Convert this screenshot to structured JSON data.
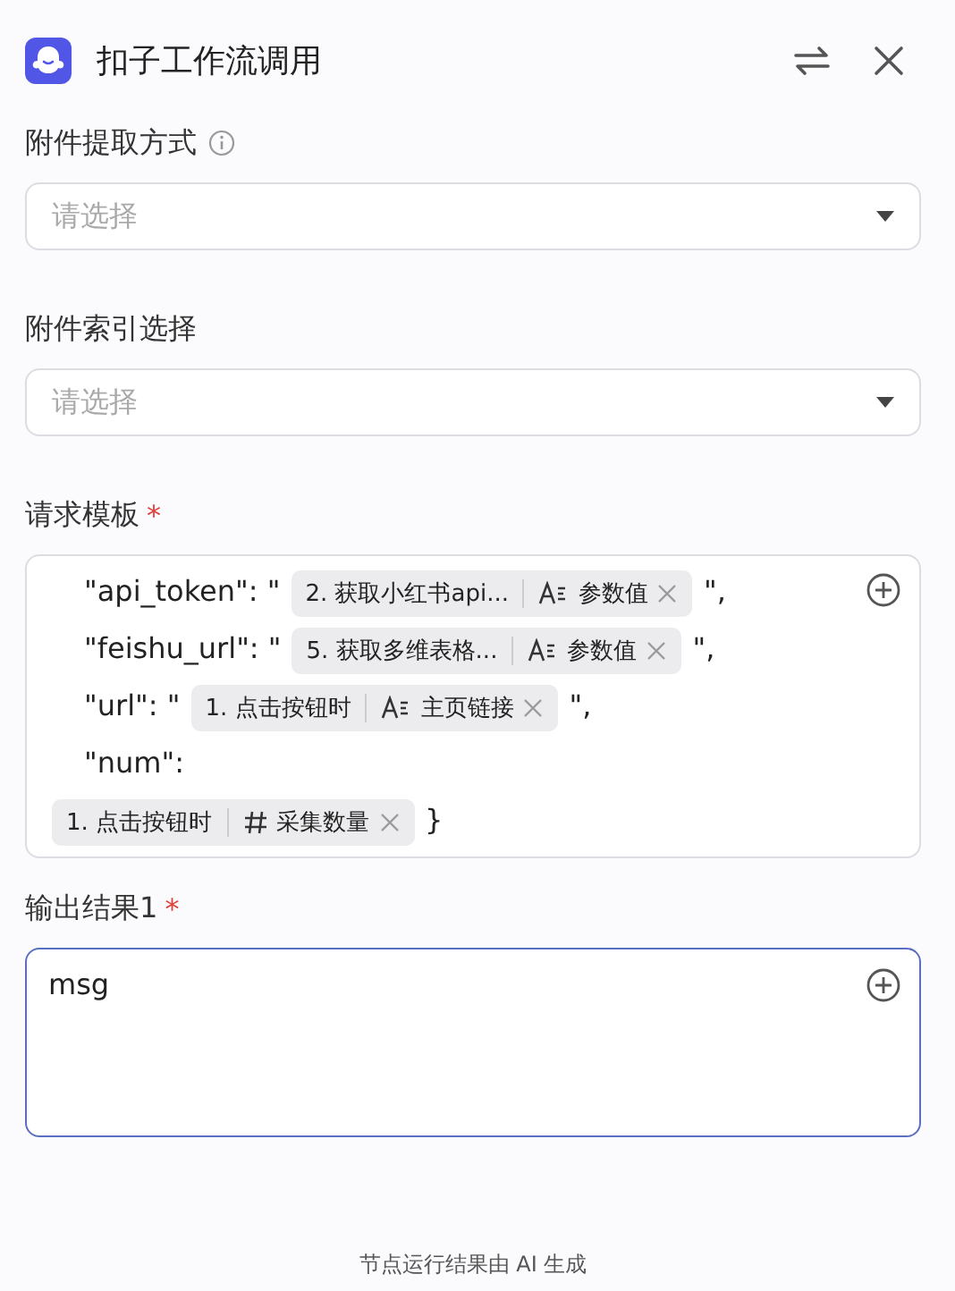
{
  "header": {
    "title": "扣子工作流调用"
  },
  "fields": [
    {
      "kind": "select",
      "label": "附件提取方式",
      "info": true,
      "placeholder": "请选择"
    },
    {
      "kind": "select",
      "label": "附件索引选择",
      "placeholder": "请选择"
    },
    {
      "kind": "template",
      "label": "请求模板",
      "required_mark": "*",
      "lines": [
        {
          "items": [
            {
              "kind": "text",
              "text": "\"api_token\": \""
            },
            {
              "kind": "string_token",
              "source": "2. 获取小红书api...",
              "name": "参数值"
            },
            {
              "kind": "text",
              "text": "\","
            }
          ]
        },
        {
          "items": [
            {
              "kind": "text",
              "text": "\"feishu_url\": \""
            },
            {
              "kind": "string_token",
              "source": "5. 获取多维表格...",
              "name": "参数值"
            },
            {
              "kind": "text",
              "text": "\","
            }
          ]
        },
        {
          "items": [
            {
              "kind": "text",
              "text": "\"url\": \""
            },
            {
              "kind": "string_token",
              "source": "1. 点击按钮时",
              "name": "主页链接"
            },
            {
              "kind": "text",
              "text": "\","
            }
          ]
        },
        {
          "items": [
            {
              "kind": "text",
              "text": "\"num\":"
            },
            {
              "kind": "line_break"
            },
            {
              "kind": "number_token",
              "source": "1. 点击按钮时",
              "name": "采集数量"
            },
            {
              "kind": "text",
              "text": "}"
            }
          ]
        }
      ]
    },
    {
      "kind": "textarea",
      "label": "输出结果1",
      "required_mark": "*",
      "value": "msg",
      "focused": true
    }
  ],
  "footer": "节点运行结果由 AI 生成"
}
